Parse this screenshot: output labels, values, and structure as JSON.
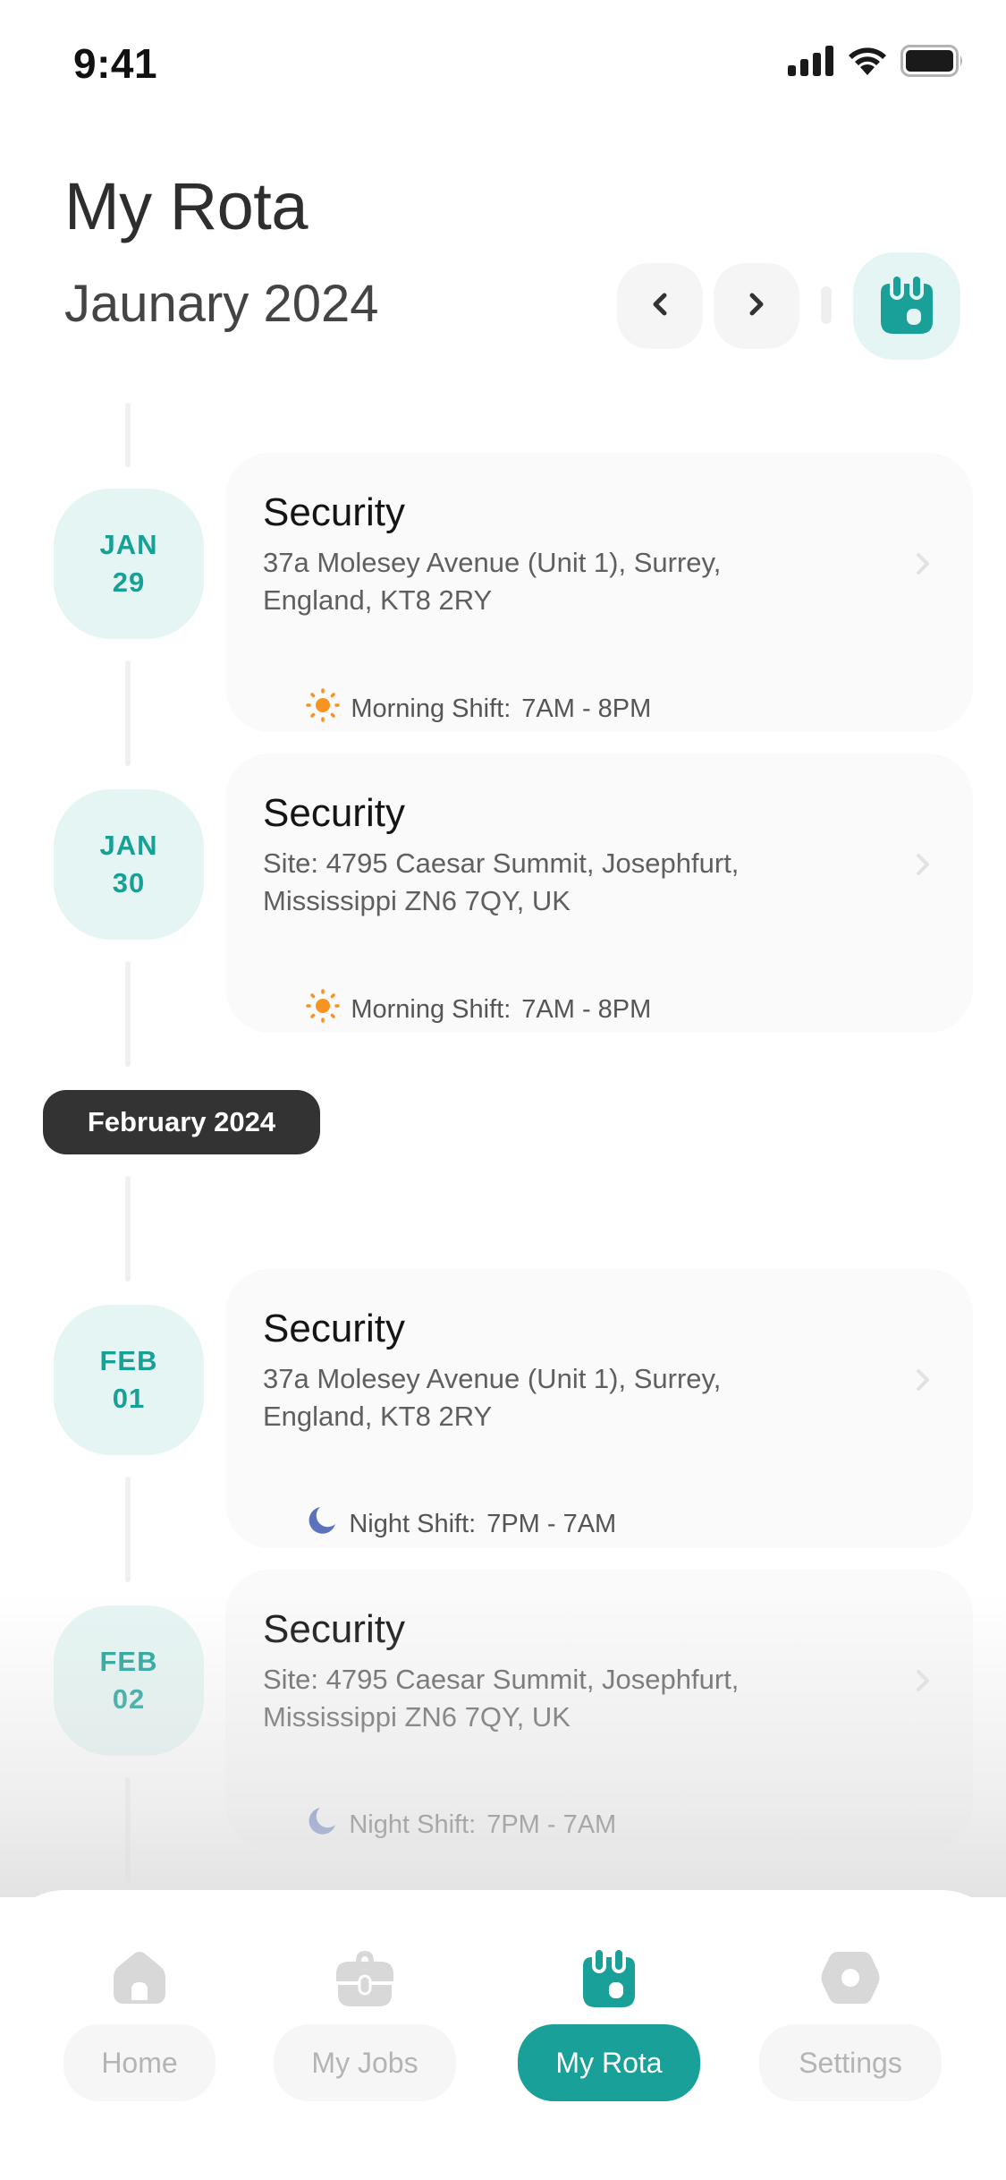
{
  "status_bar": {
    "time": "9:41",
    "icons": [
      "cellular-signal-icon",
      "wifi-icon",
      "battery-icon"
    ]
  },
  "header": {
    "title": "My Rota",
    "month": "Jaunary 2024",
    "prev_icon": "chevron-left-icon",
    "next_icon": "chevron-right-icon",
    "calendar_icon": "calendar-icon"
  },
  "colors": {
    "accent": "#19a099",
    "accent_light": "#e5f5f3",
    "morning_icon": "#f7931e",
    "night_icon": "#5b72bd",
    "month_pill": "#333333",
    "inactive_tab": "#d8d8d8"
  },
  "month_separator": "February 2024",
  "shifts": [
    {
      "month": "JAN",
      "day": "29",
      "role": "Security",
      "address": "37a Molesey Avenue (Unit 1), Surrey, England, KT8 2RY",
      "shift_type": "morning",
      "shift_icon": "sun-icon",
      "shift_label": "Morning Shift:",
      "shift_time": "7AM - 8PM"
    },
    {
      "month": "JAN",
      "day": "30",
      "role": "Security",
      "address": "Site: 4795 Caesar Summit, Josephfurt, Mississippi ZN6 7QY, UK",
      "shift_type": "morning",
      "shift_icon": "sun-icon",
      "shift_label": "Morning Shift:",
      "shift_time": "7AM - 8PM"
    },
    {
      "month": "FEB",
      "day": "01",
      "role": "Security",
      "address": "37a Molesey Avenue (Unit 1), Surrey, England, KT8 2RY",
      "shift_type": "night",
      "shift_icon": "moon-icon",
      "shift_label": "Night Shift:",
      "shift_time": "7PM - 7AM"
    },
    {
      "month": "FEB",
      "day": "02",
      "role": "Security",
      "address": "Site: 4795 Caesar Summit, Josephfurt, Mississippi ZN6 7QY, UK",
      "shift_type": "night",
      "shift_icon": "moon-icon",
      "shift_label": "Night Shift:",
      "shift_time": "7PM - 7AM"
    }
  ],
  "tab_bar": {
    "tabs": [
      {
        "label": "Home",
        "icon": "home-icon",
        "active": false
      },
      {
        "label": "My Jobs",
        "icon": "briefcase-icon",
        "active": false
      },
      {
        "label": "My Rota",
        "icon": "calendar-icon",
        "active": true
      },
      {
        "label": "Settings",
        "icon": "gear-icon",
        "active": false
      }
    ]
  }
}
